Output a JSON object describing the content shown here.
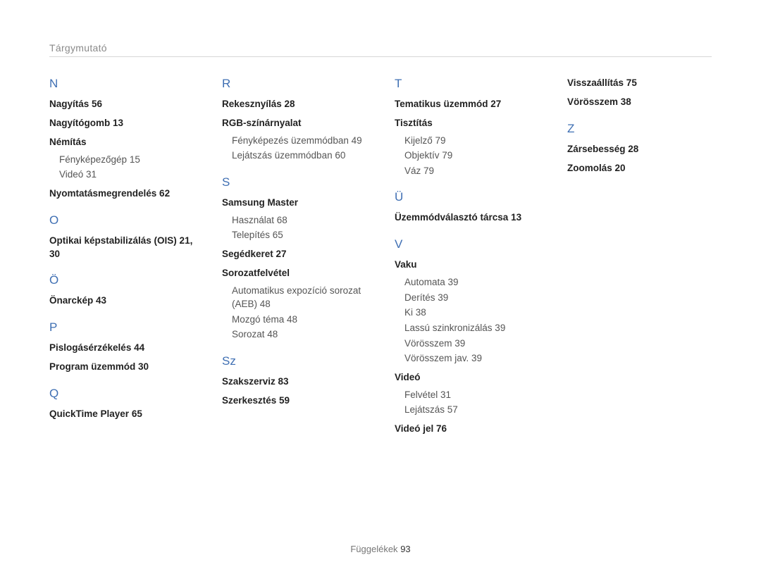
{
  "breadcrumb": "Tárgymutató",
  "footer_label": "Függelékek",
  "footer_page": "93",
  "columns": [
    {
      "sections": [
        {
          "letter": "N",
          "first": true,
          "entries": [
            {
              "bold": "Nagyítás  56"
            },
            {
              "bold": "Nagyítógomb  13"
            },
            {
              "bold": "Némítás",
              "subs": [
                "Fényképezőgép  15",
                "Videó  31"
              ]
            },
            {
              "bold": "Nyomtatásmegrendelés  62"
            }
          ]
        },
        {
          "letter": "O",
          "entries": [
            {
              "bold": "Optikai képstabilizálás (OIS)  21,  30"
            }
          ]
        },
        {
          "letter": "Ö",
          "entries": [
            {
              "bold": "Önarckép  43"
            }
          ]
        },
        {
          "letter": "P",
          "entries": [
            {
              "bold": "Pislogásérzékelés  44"
            },
            {
              "bold": "Program üzemmód  30"
            }
          ]
        },
        {
          "letter": "Q",
          "entries": [
            {
              "bold": "QuickTime Player  65"
            }
          ]
        }
      ]
    },
    {
      "sections": [
        {
          "letter": "R",
          "first": true,
          "entries": [
            {
              "bold": "Rekesznyílás  28"
            },
            {
              "bold": "RGB-színárnyalat",
              "subs": [
                "Fényképezés üzemmódban  49",
                "Lejátszás üzemmódban  60"
              ]
            }
          ]
        },
        {
          "letter": "S",
          "entries": [
            {
              "bold": "Samsung Master",
              "subs": [
                "Használat  68",
                "Telepítés  65"
              ]
            },
            {
              "bold": "Segédkeret  27"
            },
            {
              "bold": "Sorozatfelvétel",
              "subs": [
                "Automatikus expozíció sorozat (AEB)  48",
                "Mozgó téma  48",
                "Sorozat  48"
              ]
            }
          ]
        },
        {
          "letter": "Sz",
          "entries": [
            {
              "bold": "Szakszerviz  83"
            },
            {
              "bold": "Szerkesztés  59"
            }
          ]
        }
      ]
    },
    {
      "sections": [
        {
          "letter": "T",
          "first": true,
          "entries": [
            {
              "bold": "Tematikus üzemmód  27"
            },
            {
              "bold": "Tisztítás",
              "subs": [
                "Kijelző  79",
                "Objektív  79",
                "Váz  79"
              ]
            }
          ]
        },
        {
          "letter": "Ü",
          "entries": [
            {
              "bold": "Üzemmódválasztó tárcsa  13"
            }
          ]
        },
        {
          "letter": "V",
          "entries": [
            {
              "bold": "Vaku",
              "subs": [
                "Automata  39",
                "Derítés  39",
                "Ki  38",
                "Lassú szinkronizálás  39",
                "Vörösszem  39",
                "Vörösszem jav.  39"
              ]
            },
            {
              "bold": "Videó",
              "subs": [
                "Felvétel  31",
                "Lejátszás  57"
              ]
            },
            {
              "bold": "Videó jel  76"
            }
          ]
        }
      ]
    },
    {
      "sections": [
        {
          "letter": "",
          "first": true,
          "entries": [
            {
              "bold": "Visszaállítás  75"
            },
            {
              "bold": "Vörösszem  38"
            }
          ]
        },
        {
          "letter": "Z",
          "entries": [
            {
              "bold": "Zársebesség  28"
            },
            {
              "bold": "Zoomolás  20"
            }
          ]
        }
      ]
    }
  ]
}
